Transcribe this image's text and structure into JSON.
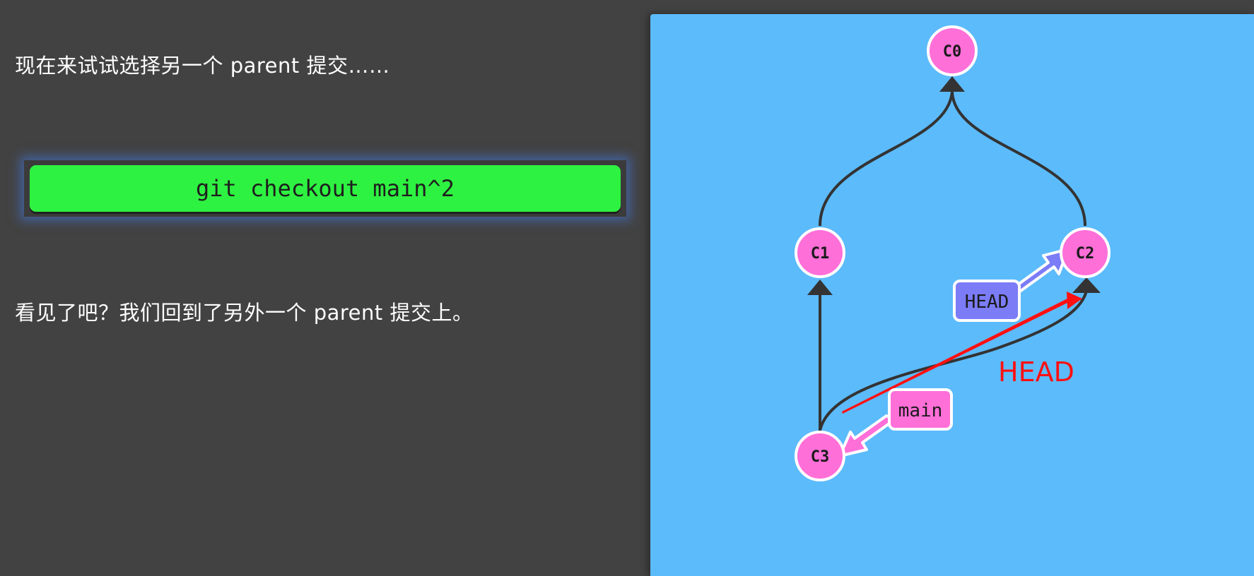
{
  "left": {
    "intro": "现在来试试选择另一个 parent 提交……",
    "command": "git checkout main^2",
    "result": "看见了吧？我们回到了另外一个 parent 提交上。"
  },
  "graph": {
    "nodes": {
      "c0": "C0",
      "c1": "C1",
      "c2": "C2",
      "c3": "C3"
    },
    "refs": {
      "head": "HEAD",
      "main": "main"
    },
    "annotation": "HEAD",
    "colors": {
      "background": "#5cbbfb",
      "node_fill": "#ff6fd8",
      "node_stroke": "#ffffff",
      "edge": "#333333",
      "head_ref": "#7b7cf6",
      "main_ref": "#ff6fd8",
      "annotation": "#ff1010"
    }
  }
}
